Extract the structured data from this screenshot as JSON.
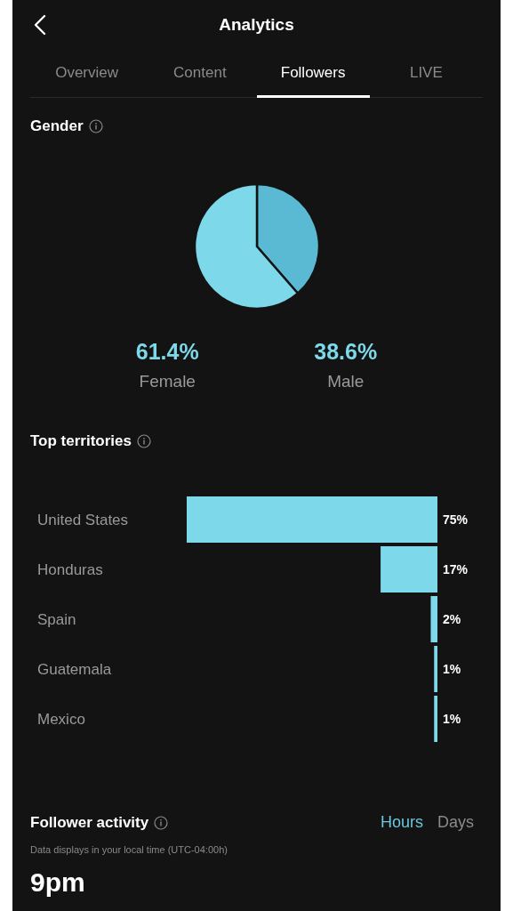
{
  "header": {
    "title": "Analytics"
  },
  "tabs": [
    {
      "label": "Overview",
      "selected": false
    },
    {
      "label": "Content",
      "selected": false
    },
    {
      "label": "Followers",
      "selected": true
    },
    {
      "label": "LIVE",
      "selected": false
    }
  ],
  "gender": {
    "title": "Gender",
    "chart_data": {
      "type": "pie",
      "categories": [
        "Female",
        "Male"
      ],
      "values": [
        61.4,
        38.6
      ],
      "colors": [
        "#7dd8ea",
        "#5bbad3"
      ],
      "value_labels": [
        "61.4%",
        "38.6%"
      ]
    }
  },
  "territories": {
    "title": "Top territories",
    "chart_data": {
      "type": "bar",
      "orientation": "horizontal",
      "categories": [
        "United States",
        "Honduras",
        "Spain",
        "Guatemala",
        "Mexico"
      ],
      "series": [
        {
          "color": "#7dd8ea",
          "values": [
            75,
            17,
            2,
            1,
            1
          ],
          "value_labels": [
            "75%",
            "17%",
            "2%",
            "1%",
            "1%"
          ]
        }
      ]
    }
  },
  "activity": {
    "title": "Follower activity",
    "toggles": [
      {
        "label": "Hours",
        "selected": true
      },
      {
        "label": "Days",
        "selected": false
      }
    ],
    "note": "Data displays in your local time (UTC-04:00h)",
    "peak": "9pm"
  }
}
